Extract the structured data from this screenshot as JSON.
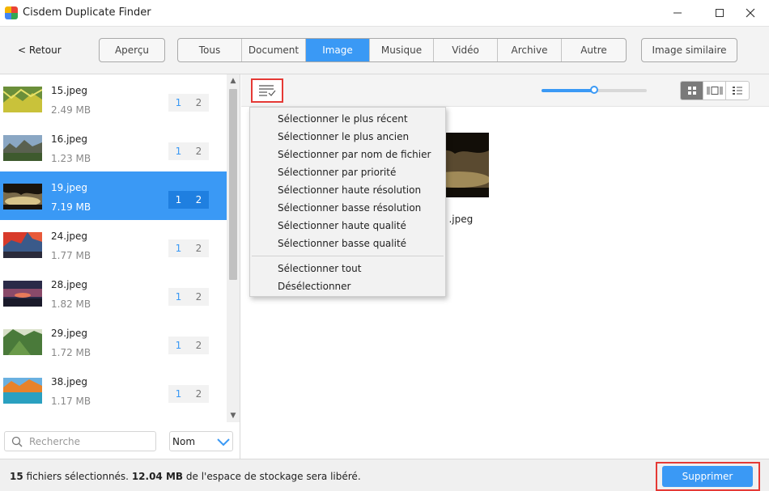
{
  "window": {
    "title": "Cisdem Duplicate Finder"
  },
  "toolbar": {
    "back_label": "< Retour",
    "preview_label": "Aperçu",
    "similar_label": "Image similaire",
    "tabs": [
      {
        "label": "Tous",
        "active": false
      },
      {
        "label": "Document",
        "active": false
      },
      {
        "label": "Image",
        "active": true
      },
      {
        "label": "Musique",
        "active": false
      },
      {
        "label": "Vidéo",
        "active": false
      },
      {
        "label": "Archive",
        "active": false
      },
      {
        "label": "Autre",
        "active": false
      }
    ]
  },
  "files": [
    {
      "name": "15.jpeg",
      "size": "2.49 MB",
      "count_a": "1",
      "count_b": "2",
      "selected": false
    },
    {
      "name": "16.jpeg",
      "size": "1.23 MB",
      "count_a": "1",
      "count_b": "2",
      "selected": false
    },
    {
      "name": "19.jpeg",
      "size": "7.19 MB",
      "count_a": "1",
      "count_b": "2",
      "selected": true
    },
    {
      "name": "24.jpeg",
      "size": "1.77 MB",
      "count_a": "1",
      "count_b": "2",
      "selected": false
    },
    {
      "name": "28.jpeg",
      "size": "1.82 MB",
      "count_a": "1",
      "count_b": "2",
      "selected": false
    },
    {
      "name": "29.jpeg",
      "size": "1.72 MB",
      "count_a": "1",
      "count_b": "2",
      "selected": false
    },
    {
      "name": "38.jpeg",
      "size": "1.17 MB",
      "count_a": "1",
      "count_b": "2",
      "selected": false
    }
  ],
  "search": {
    "placeholder": "Recherche",
    "value": ""
  },
  "sort": {
    "selected": "Nom"
  },
  "main": {
    "thumbnail_size_fraction": 0.5,
    "preview_name": ") .jpeg"
  },
  "menu": {
    "items": [
      "Sélectionner le plus récent",
      "Sélectionner le plus ancien",
      "Sélectionner par nom de fichier",
      "Sélectionner par priorité",
      "Sélectionner haute résolution",
      "Sélectionner basse résolution",
      "Sélectionner haute qualité",
      "Sélectionner basse qualité"
    ],
    "select_all": "Sélectionner tout",
    "deselect": "Désélectionner"
  },
  "status": {
    "count": "15",
    "count_label": "fichiers sélectionnés.",
    "size": "12.04 MB",
    "size_label": "de l'espace de stockage sera libéré."
  },
  "actions": {
    "delete_label": "Supprimer"
  },
  "colors": {
    "accent": "#3a99f5",
    "highlight": "#e53935"
  }
}
